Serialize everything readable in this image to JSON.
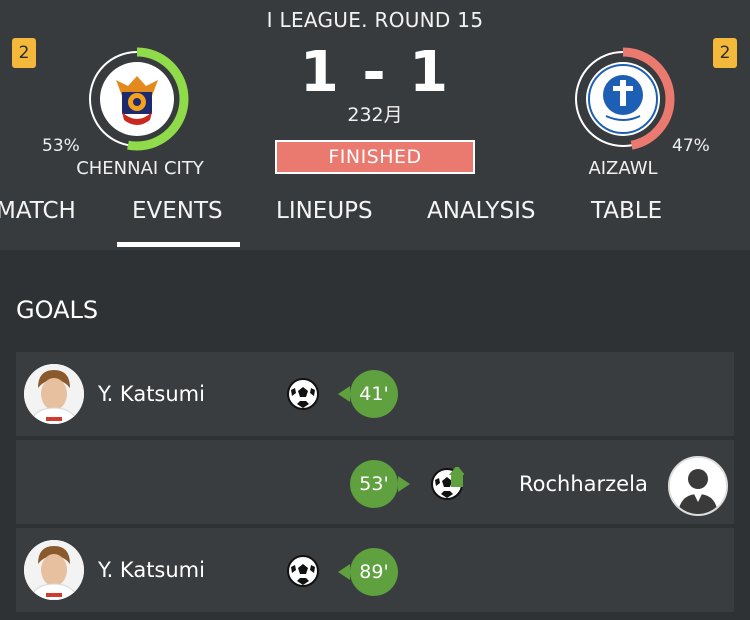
{
  "header": {
    "league": "I LEAGUE. ROUND 15",
    "score": "1 - 1",
    "date": "232月",
    "status": "FINISHED",
    "home": {
      "name": "CHENNAI CITY",
      "badge": "2",
      "possession": "53%",
      "possession_value": 53,
      "ring_color": "#8fdb4a"
    },
    "away": {
      "name": "AIZAWL",
      "badge": "2",
      "possession": "47%",
      "possession_value": 47,
      "ring_color": "#ea7a70"
    }
  },
  "tabs": [
    {
      "label": "MATCH",
      "active": false
    },
    {
      "label": "EVENTS",
      "active": true
    },
    {
      "label": "LINEUPS",
      "active": false
    },
    {
      "label": "ANALYSIS",
      "active": false
    },
    {
      "label": "TABLE",
      "active": false
    }
  ],
  "goals": {
    "title": "GOALS",
    "events": [
      {
        "player": "Y. Katsumi",
        "minute": "41'",
        "side": "home",
        "icon": "football-icon"
      },
      {
        "player": "Rochharzela",
        "minute": "53'",
        "side": "away",
        "icon": "football-assist-icon"
      },
      {
        "player": "Y. Katsumi",
        "minute": "89'",
        "side": "home",
        "icon": "football-icon"
      }
    ]
  },
  "colors": {
    "minute_bubble": "#5fa03f",
    "status_bg": "#ea7a70",
    "badge": "#f4b93a"
  }
}
